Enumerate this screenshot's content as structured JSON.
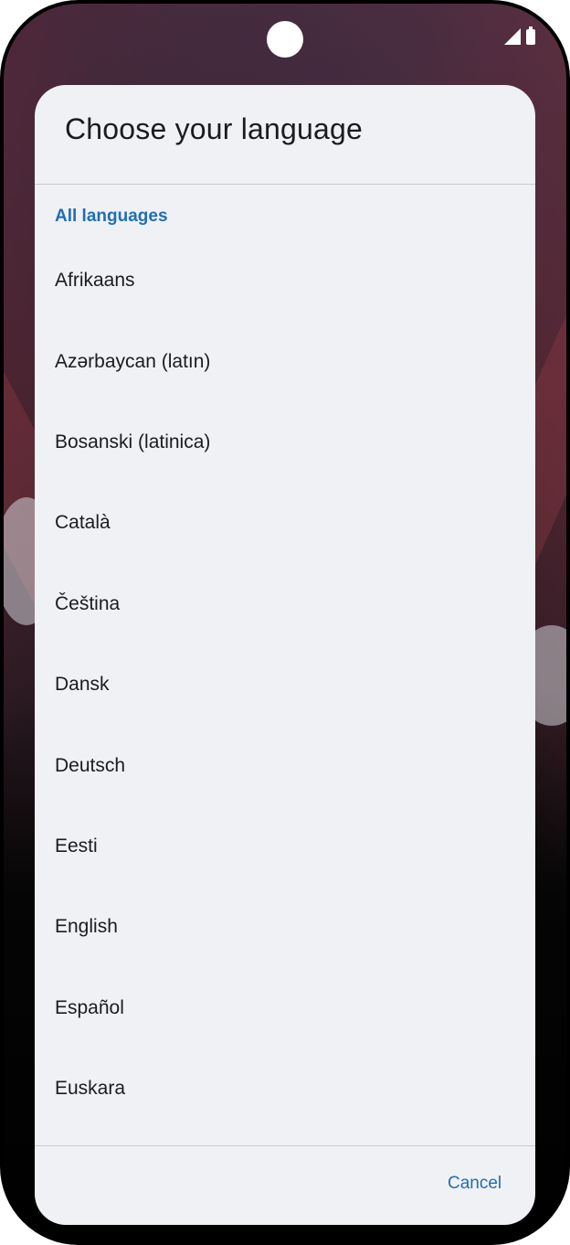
{
  "dialog": {
    "title": "Choose your language",
    "section_header": "All languages",
    "languages": [
      "Afrikaans",
      "Azərbaycan (latın)",
      "Bosanski (latinica)",
      "Català",
      "Čeština",
      "Dansk",
      "Deutsch",
      "Eesti",
      "English",
      "Español",
      "Euskara"
    ],
    "cancel_label": "Cancel"
  },
  "colors": {
    "accent": "#1f6fb5",
    "dialog_background": "#f0f1f4",
    "text_primary": "#1c1c1e",
    "divider": "#c9cbd0"
  },
  "icons": [
    "front-camera",
    "cellular-signal-icon",
    "battery-icon"
  ]
}
